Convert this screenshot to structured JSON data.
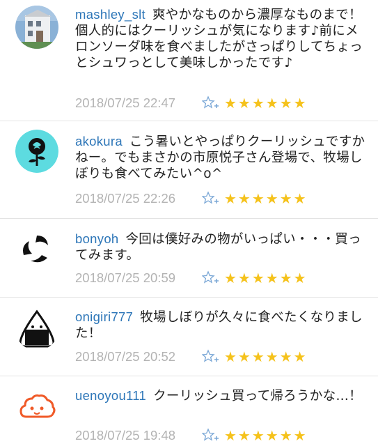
{
  "comments": [
    {
      "username": "mashley_slt",
      "text": "爽やかなものから濃厚なものまで！個人的にはクーリッシュが気になります♪前にメロンソーダ味を食べましたがさっぱりしてちょっとシュワっとして美味しかったです♪",
      "time": "2018/07/25 22:47",
      "stars": "★★★★★★",
      "avatar": "house-photo-avatar"
    },
    {
      "username": "akokura",
      "text": "こう暑いとやっぱりクーリッシュですかねー。でもまさかの市原悦子さん登場で、牧場しぼりも食べてみたい^o^",
      "time": "2018/07/25 22:26",
      "stars": "★★★★★★",
      "avatar": "rose-avatar"
    },
    {
      "username": "bonyoh",
      "text": "今回は僕好みの物がいっぱい・・・買ってみます。",
      "time": "2018/07/25 20:59",
      "stars": "★★★★★★",
      "avatar": "mitsudomoe-avatar"
    },
    {
      "username": "onigiri777",
      "text": "牧場しぼりが久々に食べたくなりました！",
      "time": "2018/07/25 20:52",
      "stars": "★★★★★★",
      "avatar": "onigiri-avatar"
    },
    {
      "username": "uenoyou111",
      "text": "クーリッシュ買って帰ろうかな…！",
      "time": "2018/07/25 19:48",
      "stars": "★★★★★★",
      "avatar": "cloud-face-avatar"
    }
  ],
  "colors": {
    "username": "#2d76b8",
    "time": "#b3b3b3",
    "star": "#f5c21b",
    "fav_icon": "#7aa7d6"
  },
  "icons": {
    "fav": "star-plus-icon"
  }
}
